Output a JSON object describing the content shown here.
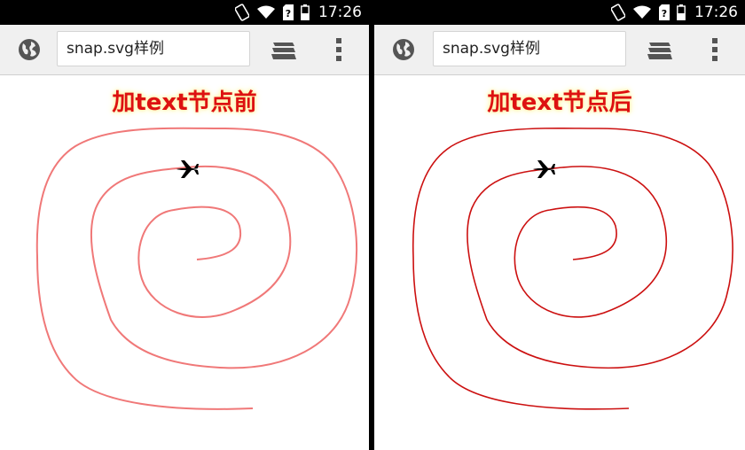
{
  "status_bar": {
    "time": "17:26",
    "icons": [
      "screen-rotation-icon",
      "wifi-icon",
      "sim-alert-icon",
      "battery-icon"
    ]
  },
  "browser": {
    "url_text": "snap.svg样例",
    "icons": [
      "globe-icon",
      "tabs-icon",
      "overflow-menu-icon"
    ]
  },
  "panels": [
    {
      "heading": "加text节点前",
      "path_color": "#f07878"
    },
    {
      "heading": "加text节点后",
      "path_color": "#cc1010"
    }
  ],
  "colors": {
    "heading": "#dd1111",
    "heading_glow": "#fff3a0",
    "toolbar": "#f0f0f0"
  }
}
